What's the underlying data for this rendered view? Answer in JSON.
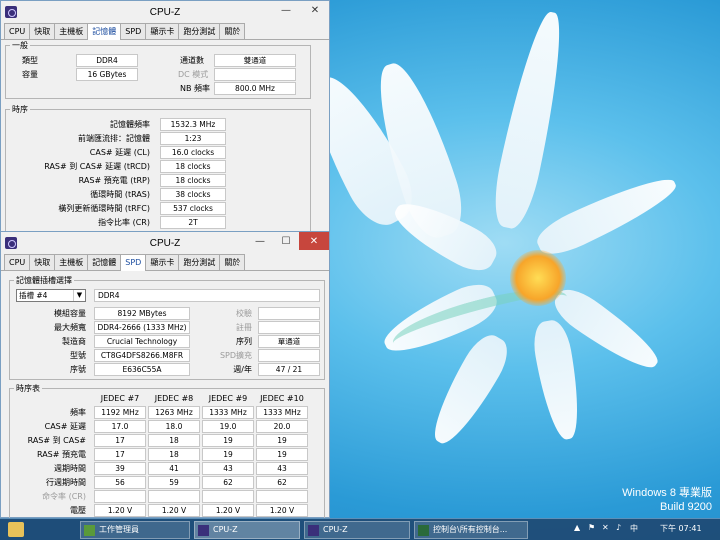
{
  "desktop": {
    "watermark_line1": "Windows 8 專業版",
    "watermark_line2": "Build 9200"
  },
  "win1": {
    "title": "CPU-Z",
    "minimize": "—",
    "close": "✕",
    "tabs": [
      "CPU",
      "快取",
      "主機板",
      "記憶體",
      "SPD",
      "顯示卡",
      "跑分測試",
      "關於"
    ],
    "general": {
      "title": "一般",
      "type_label": "類型",
      "type_value": "DDR4",
      "size_label": "容量",
      "size_value": "16 GBytes",
      "channels_label": "通道數",
      "channels_value": "雙通道",
      "dcmode_label": "DC 模式",
      "dcmode_value": "",
      "nbfreq_label": "NB 頻率",
      "nbfreq_value": "800.0 MHz"
    },
    "timings": {
      "title": "時序",
      "rows": [
        {
          "label": "記憶體頻率",
          "value": "1532.3 MHz"
        },
        {
          "label": "前端匯流排：記憶體",
          "value": "1:23"
        },
        {
          "label": "CAS# 延遲 (CL)",
          "value": "16.0 clocks"
        },
        {
          "label": "RAS# 到 CAS# 延遲 (tRCD)",
          "value": "18 clocks"
        },
        {
          "label": "RAS# 預充電 (tRP)",
          "value": "18 clocks"
        },
        {
          "label": "循環時間 (tRAS)",
          "value": "38 clocks"
        },
        {
          "label": "橫列更新循環時間 (tRFC)",
          "value": "537 clocks"
        },
        {
          "label": "指令比率 (CR)",
          "value": "2T"
        }
      ]
    }
  },
  "win2": {
    "title": "CPU-Z",
    "minimize": "—",
    "maximize": "☐",
    "close": "✕",
    "tabs": [
      "CPU",
      "快取",
      "主機板",
      "記憶體",
      "SPD",
      "顯示卡",
      "跑分測試",
      "關於"
    ],
    "slot": {
      "title": "記憶體插槽選擇",
      "slot_value": "插槽 #4",
      "type_value": "DDR4",
      "module_size_label": "模組容量",
      "module_size_value": "8192 MBytes",
      "max_bw_label": "最大頻寬",
      "max_bw_value": "DDR4-2666 (1333 MHz)",
      "manufacturer_label": "製造商",
      "manufacturer_value": "Crucial Technology",
      "part_label": "型號",
      "part_value": "CT8G4DFS8266.M8FR",
      "serial_label": "序號",
      "serial_value": "E636C55A",
      "correction_label": "校驗",
      "correction_value": "",
      "registered_label": "註冊",
      "registered_value": "",
      "ranks_label": "序列",
      "ranks_value": "單通道",
      "spd_ext_label": "SPD擴充",
      "spd_ext_value": "",
      "week_label": "週/年",
      "week_value": "47 / 21"
    },
    "timing_table": {
      "title": "時序表",
      "columns": [
        "JEDEC #7",
        "JEDEC #8",
        "JEDEC #9",
        "JEDEC #10"
      ],
      "rows": [
        {
          "label": "頻率",
          "values": [
            "1192 MHz",
            "1263 MHz",
            "1333 MHz",
            "1333 MHz"
          ]
        },
        {
          "label": "CAS# 延遲",
          "values": [
            "17.0",
            "18.0",
            "19.0",
            "20.0"
          ]
        },
        {
          "label": "RAS# 到 CAS#",
          "values": [
            "17",
            "18",
            "19",
            "19"
          ]
        },
        {
          "label": "RAS# 預充電",
          "values": [
            "17",
            "18",
            "19",
            "19"
          ]
        },
        {
          "label": "週期時間",
          "values": [
            "39",
            "41",
            "43",
            "43"
          ]
        },
        {
          "label": "行週期時間",
          "values": [
            "56",
            "59",
            "62",
            "62"
          ]
        },
        {
          "label": "命令率 (CR)",
          "values": [
            "",
            "",
            "",
            ""
          ]
        },
        {
          "label": "電壓",
          "values": [
            "1.20 V",
            "1.20 V",
            "1.20 V",
            "1.20 V"
          ]
        }
      ]
    }
  },
  "taskbar": {
    "items": [
      "工作管理員",
      "CPU-Z",
      "CPU-Z",
      "控制台\\所有控制台..."
    ],
    "clock": "下午 07:41"
  }
}
